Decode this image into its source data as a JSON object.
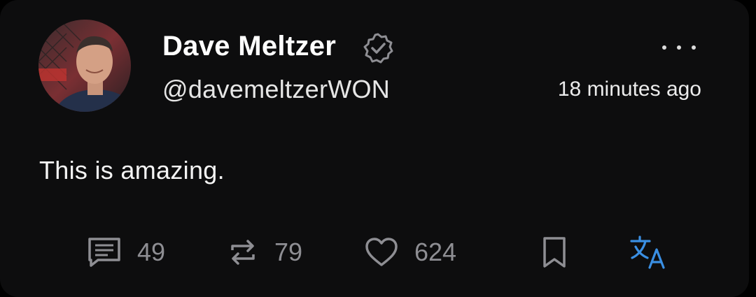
{
  "post": {
    "author": {
      "display_name": "Dave Meltzer",
      "handle": "@davemeltzerWON",
      "verified": true,
      "avatar_icon": "profile-photo"
    },
    "timestamp": "18 minutes ago",
    "text": "This is amazing."
  },
  "actions": {
    "replies": {
      "icon": "comment-icon",
      "count": "49"
    },
    "reposts": {
      "icon": "repost-icon",
      "count": "79"
    },
    "likes": {
      "icon": "heart-icon",
      "count": "624"
    },
    "bookmark": {
      "icon": "bookmark-icon"
    },
    "translate": {
      "icon": "translate-icon"
    }
  },
  "colors": {
    "background": "#000000",
    "card": "#0d0d0e",
    "text_primary": "#ffffff",
    "text_muted": "#8e8e93",
    "accent_translate": "#3a8fe3"
  }
}
